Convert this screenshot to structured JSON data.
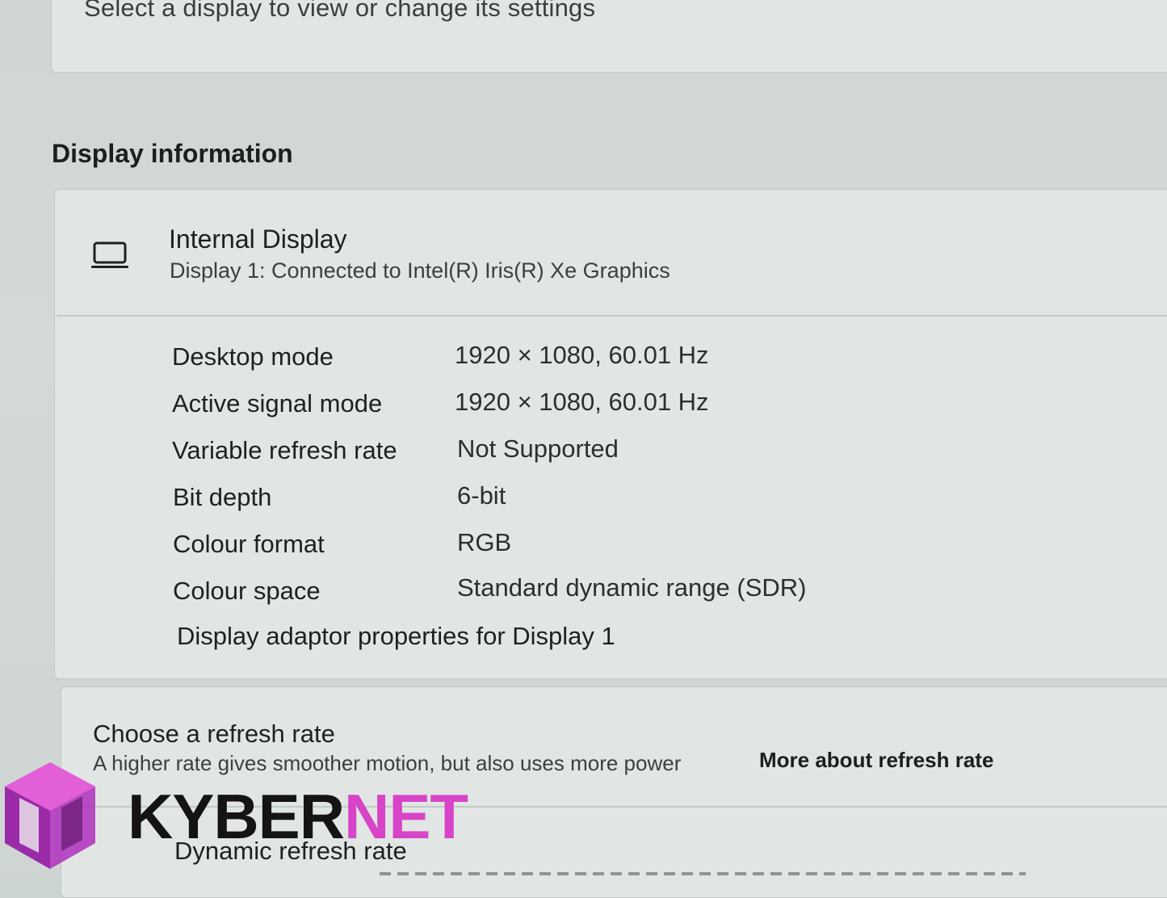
{
  "select_display": {
    "prompt": "Select a display to view or change its settings"
  },
  "display_information": {
    "heading": "Display information",
    "display_name": "Internal Display",
    "display_subtitle": "Display 1: Connected to Intel(R) Iris(R) Xe Graphics",
    "properties": [
      {
        "label": "Desktop mode",
        "value": "1920 × 1080, 60.01 Hz"
      },
      {
        "label": "Active signal mode",
        "value": "1920 × 1080, 60.01 Hz"
      },
      {
        "label": "Variable refresh rate",
        "value": "Not Supported"
      },
      {
        "label": "Bit depth",
        "value": "6-bit"
      },
      {
        "label": "Colour format",
        "value": "RGB"
      },
      {
        "label": "Colour space",
        "value": "Standard dynamic range (SDR)"
      }
    ],
    "adaptor_link": "Display adaptor properties for Display 1"
  },
  "refresh_rate": {
    "title": "Choose a refresh rate",
    "description": "A higher rate gives smoother motion, but also uses more power",
    "more_link": "More about refresh rate",
    "dynamic_label": "Dynamic refresh rate"
  },
  "watermark": {
    "brand_dark": "KYBER",
    "brand_accent": "NET",
    "accent_color": "#d744c8",
    "logo_color": "#c040c8"
  }
}
